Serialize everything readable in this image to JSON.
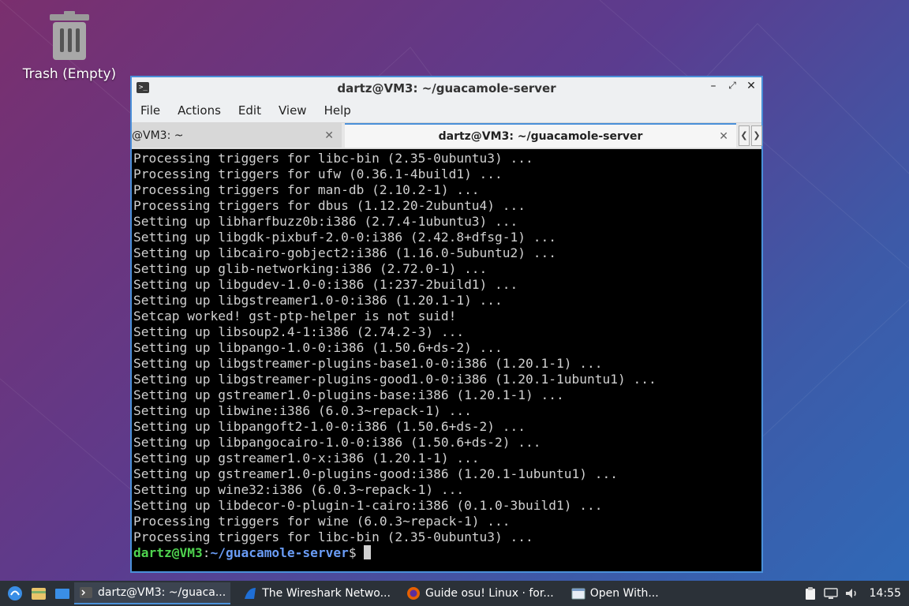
{
  "desktop": {
    "trash_label": "Trash (Empty)"
  },
  "window": {
    "title": "dartz@VM3: ~/guacamole-server",
    "menu": [
      "File",
      "Actions",
      "Edit",
      "View",
      "Help"
    ],
    "tabs": [
      {
        "label": "@VM3: ~"
      },
      {
        "label": "dartz@VM3: ~/guacamole-server"
      }
    ],
    "terminal_lines": [
      "Processing triggers for libc-bin (2.35-0ubuntu3) ...",
      "Processing triggers for ufw (0.36.1-4build1) ...",
      "Processing triggers for man-db (2.10.2-1) ...",
      "Processing triggers for dbus (1.12.20-2ubuntu4) ...",
      "Setting up libharfbuzz0b:i386 (2.7.4-1ubuntu3) ...",
      "Setting up libgdk-pixbuf-2.0-0:i386 (2.42.8+dfsg-1) ...",
      "Setting up libcairo-gobject2:i386 (1.16.0-5ubuntu2) ...",
      "Setting up glib-networking:i386 (2.72.0-1) ...",
      "Setting up libgudev-1.0-0:i386 (1:237-2build1) ...",
      "Setting up libgstreamer1.0-0:i386 (1.20.1-1) ...",
      "Setcap worked! gst-ptp-helper is not suid!",
      "Setting up libsoup2.4-1:i386 (2.74.2-3) ...",
      "Setting up libpango-1.0-0:i386 (1.50.6+ds-2) ...",
      "Setting up libgstreamer-plugins-base1.0-0:i386 (1.20.1-1) ...",
      "Setting up libgstreamer-plugins-good1.0-0:i386 (1.20.1-1ubuntu1) ...",
      "Setting up gstreamer1.0-plugins-base:i386 (1.20.1-1) ...",
      "Setting up libwine:i386 (6.0.3~repack-1) ...",
      "Setting up libpangoft2-1.0-0:i386 (1.50.6+ds-2) ...",
      "Setting up libpangocairo-1.0-0:i386 (1.50.6+ds-2) ...",
      "Setting up gstreamer1.0-x:i386 (1.20.1-1) ...",
      "Setting up gstreamer1.0-plugins-good:i386 (1.20.1-1ubuntu1) ...",
      "Setting up wine32:i386 (6.0.3~repack-1) ...",
      "Setting up libdecor-0-plugin-1-cairo:i386 (0.1.0-3build1) ...",
      "Processing triggers for wine (6.0.3~repack-1) ...",
      "Processing triggers for libc-bin (2.35-0ubuntu3) ..."
    ],
    "prompt": {
      "user_host": "dartz@VM3",
      "sep": ":",
      "path": "~/guacamole-server",
      "symbol": "$ "
    }
  },
  "taskbar": {
    "tasks": [
      {
        "label": "dartz@VM3: ~/guaca..."
      },
      {
        "label": "The Wireshark Netwo..."
      },
      {
        "label": "Guide osu! Linux · for..."
      },
      {
        "label": "Open With..."
      }
    ],
    "clock": "14:55"
  },
  "colors": {
    "accent": "#4a90d9",
    "prompt_user": "#4fd44f",
    "prompt_path": "#6a9cf5",
    "terminal_bg": "#000000",
    "terminal_fg": "#d0d0d0",
    "taskbar_bg": "#2b3138"
  }
}
